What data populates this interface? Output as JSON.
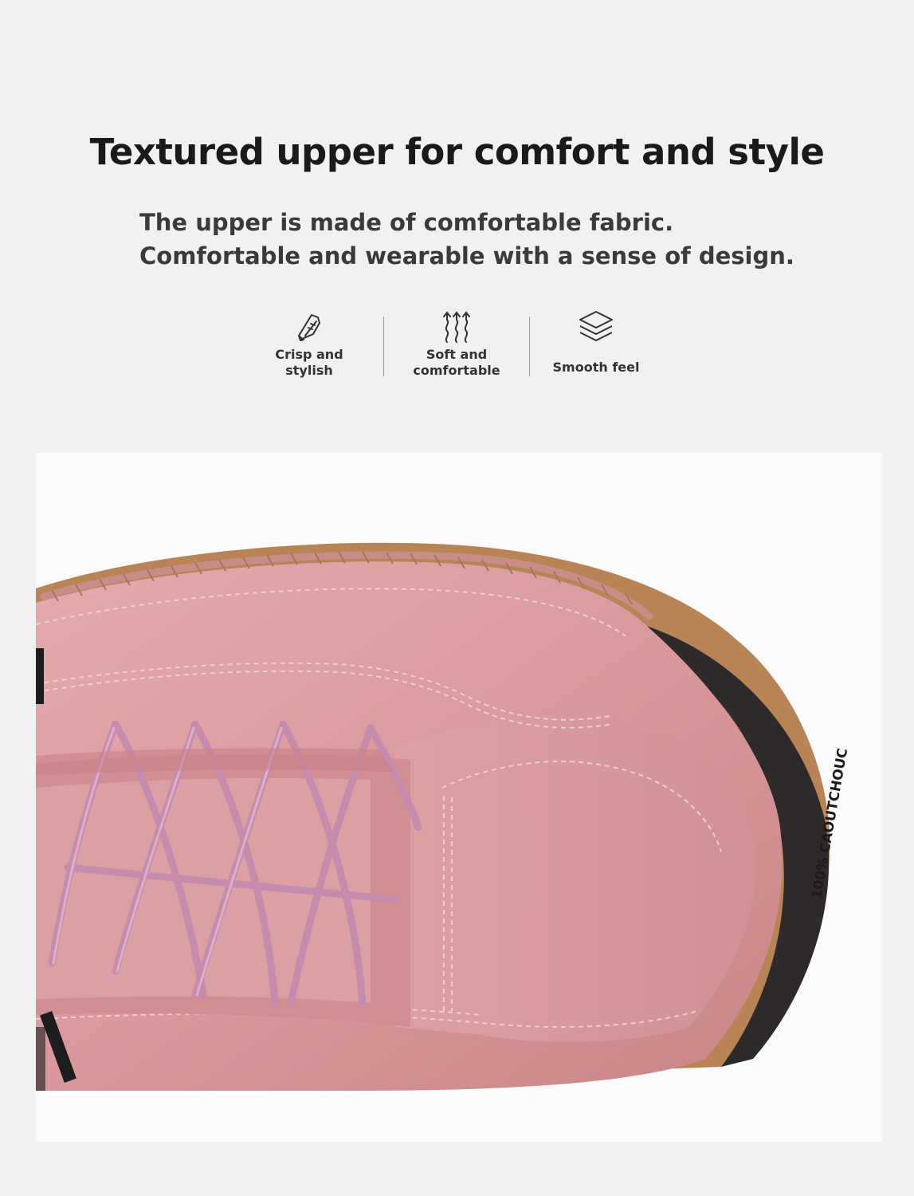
{
  "headline": "Textured upper for comfort and style",
  "subtext": [
    "The upper is made of comfortable fabric.",
    "Comfortable and wearable with a sense of design."
  ],
  "features": [
    {
      "icon": "shoe-icon",
      "lines": [
        "Crisp and",
        "stylish"
      ]
    },
    {
      "icon": "heat-waves-icon",
      "lines": [
        "Soft and",
        "comfortable"
      ]
    },
    {
      "icon": "layers-icon",
      "lines": [
        "Smooth feel"
      ]
    }
  ],
  "product_image": {
    "subject": "pink leather shoe close-up",
    "sole_text": "100% CAOUTCHOUC",
    "colors": {
      "upper": "#d99a9c",
      "laces": "#c98fb0",
      "sole": "#2b2b2b",
      "stitching": "#b98a5e"
    }
  }
}
